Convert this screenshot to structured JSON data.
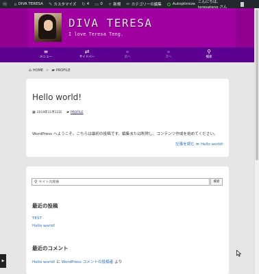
{
  "adminbar": {
    "wp_icon": "wordpress-icon",
    "site_name": "DIVA TERESA",
    "customize": "カスタマイズ",
    "updates_count": "4",
    "comments_count": "0",
    "new": "新規",
    "edit_category": "カテゴリーの編集",
    "autoptimize": "Autoptimize",
    "greeting": "こんにちは、 teresateng さん"
  },
  "header": {
    "title": "DIVA TERESA",
    "description": "I love Teresa Teng."
  },
  "nav": [
    {
      "icon": "≡",
      "label": "メニュー"
    },
    {
      "icon": "⇄",
      "label": "サイドバー"
    },
    {
      "icon": "«",
      "label": "前へ"
    },
    {
      "icon": "»",
      "label": "次へ"
    },
    {
      "icon": "⚲",
      "label": "検索"
    }
  ],
  "breadcrumb": {
    "home": "HOME",
    "sep": ">",
    "current": "PROFILE"
  },
  "post": {
    "title": "Hello world!",
    "date": "2019年11月12日",
    "category": "PROFILE",
    "body": "WordPress へようこそ。こちらは最初の投稿です。編集または削除し、コンテンツ作成を始めてください。",
    "read_more": "記事を読む ≫ Hello world!"
  },
  "sidebar": {
    "search_placeholder": "サイト内検索",
    "search_button": "検索",
    "recent_posts_title": "最近の投稿",
    "recent_posts": [
      "TEST",
      "Hello world!"
    ],
    "recent_comments_title": "最近のコメント",
    "comment": {
      "post": "Hello world!",
      "on": " に ",
      "author": "WordPress コメントの投稿者",
      "by": " より"
    }
  },
  "colors": {
    "adminbar": "#23282d",
    "header": "#a000a0",
    "nav": "#5c0092",
    "link": "#2a6fc4"
  }
}
